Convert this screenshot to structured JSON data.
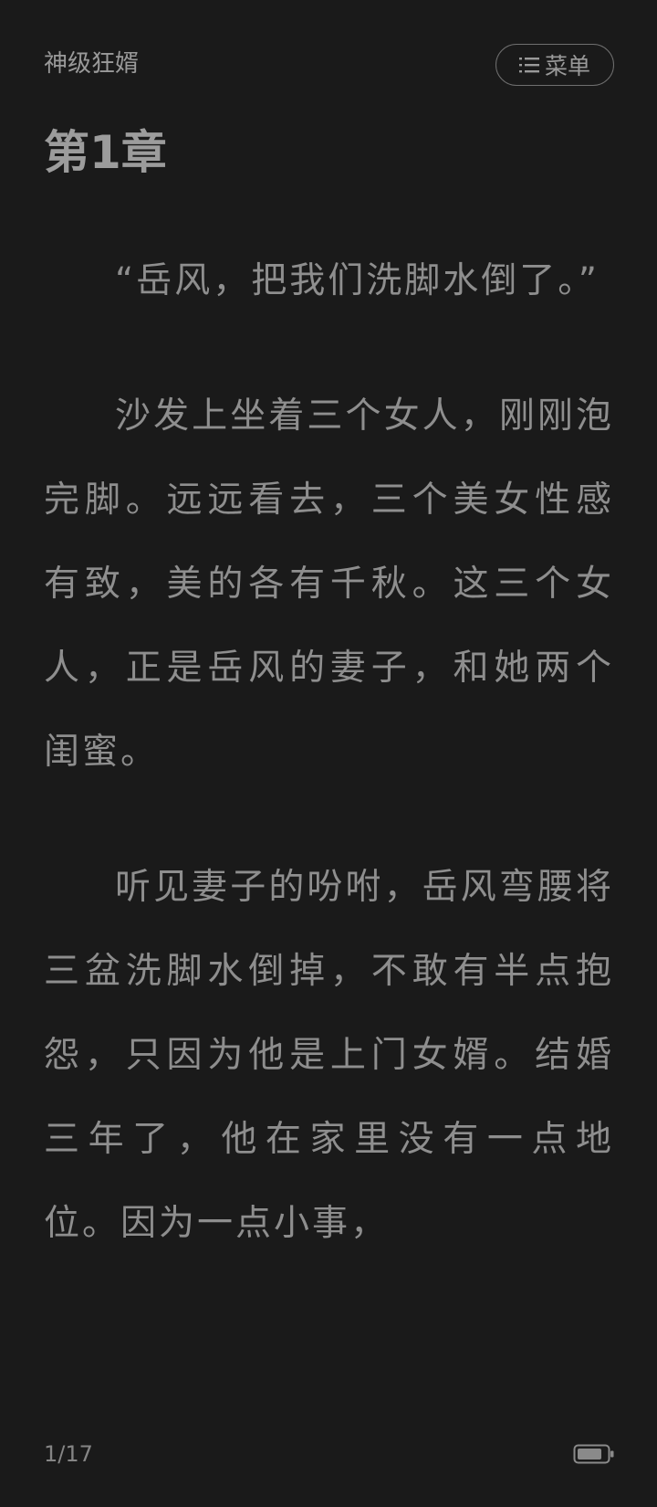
{
  "header": {
    "book_title": "神级狂婿",
    "menu_label": "菜单",
    "menu_icon": "list-icon"
  },
  "chapter": {
    "title": "第1章",
    "paragraphs": [
      "“岳风，把我们洗脚水倒了。”",
      "沙发上坐着三个女人，刚刚泡完脚。远远看去，三个美女性感有致，美的各有千秋。这三个女人，正是岳风的妻子，和她两个闺蜜。",
      "听见妻子的吩咐，岳风弯腰将三盆洗脚水倒掉，不敢有半点抱怨，只因为他是上门女婿。结婚三年了，他在家里没有一点地位。因为一点小事，"
    ]
  },
  "footer": {
    "page_indicator": "1/17",
    "battery_icon": "battery-icon"
  },
  "colors": {
    "background": "#1a1a1a",
    "text": "#8e8e8e"
  }
}
